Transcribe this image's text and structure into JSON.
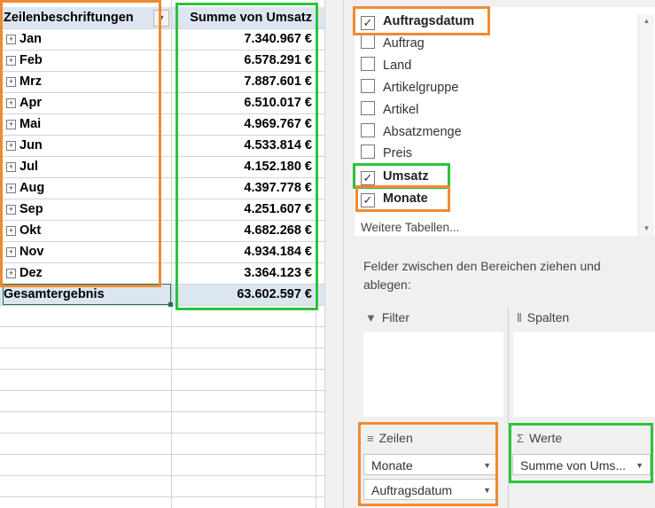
{
  "pivot": {
    "header_row_labels": "Zeilenbeschriftungen",
    "header_values": "Summe von Umsatz",
    "filter_button_icon": "dropdown-arrow-icon",
    "rows": [
      {
        "label": "Jan",
        "value": "7.340.967 €"
      },
      {
        "label": "Feb",
        "value": "6.578.291 €"
      },
      {
        "label": "Mrz",
        "value": "7.887.601 €"
      },
      {
        "label": "Apr",
        "value": "6.510.017 €"
      },
      {
        "label": "Mai",
        "value": "4.969.767 €"
      },
      {
        "label": "Jun",
        "value": "4.533.814 €"
      },
      {
        "label": "Jul",
        "value": "4.152.180 €"
      },
      {
        "label": "Aug",
        "value": "4.397.778 €"
      },
      {
        "label": "Sep",
        "value": "4.251.607 €"
      },
      {
        "label": "Okt",
        "value": "4.682.268 €"
      },
      {
        "label": "Nov",
        "value": "4.934.184 €"
      },
      {
        "label": "Dez",
        "value": "3.364.123 €"
      }
    ],
    "total_label": "Gesamtergebnis",
    "total_value": "63.602.597 €"
  },
  "field_pane": {
    "fields": [
      {
        "name": "Auftragsdatum",
        "checked": true
      },
      {
        "name": "Auftrag",
        "checked": false
      },
      {
        "name": "Land",
        "checked": false
      },
      {
        "name": "Artikelgruppe",
        "checked": false
      },
      {
        "name": "Artikel",
        "checked": false
      },
      {
        "name": "Absatzmenge",
        "checked": false
      },
      {
        "name": "Preis",
        "checked": false
      },
      {
        "name": "Umsatz",
        "checked": true
      },
      {
        "name": "Monate",
        "checked": true
      }
    ],
    "more_tables": "Weitere Tabellen...",
    "drag_instruction": "Felder zwischen den Bereichen ziehen und ablegen:",
    "areas": {
      "filter": {
        "title": "Filter",
        "icon": "filter-icon"
      },
      "columns": {
        "title": "Spalten",
        "icon": "columns-icon"
      },
      "rows": {
        "title": "Zeilen",
        "icon": "rows-icon",
        "items": [
          "Monate",
          "Auftragsdatum"
        ]
      },
      "values": {
        "title": "Werte",
        "icon": "sigma-icon",
        "items": [
          "Summe von Ums..."
        ]
      }
    }
  },
  "highlight_colors": {
    "orange": "#f08a32",
    "green": "#2ec13c"
  }
}
